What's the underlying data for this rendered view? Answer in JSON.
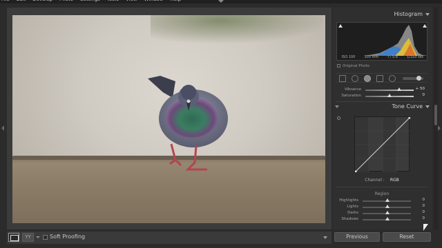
{
  "menubar": {
    "items": [
      "File",
      "Edit",
      "Develop",
      "Photo",
      "Settings",
      "Tools",
      "View",
      "Window",
      "Help"
    ]
  },
  "toolbar": {
    "view_icon": "loupe-view-icon",
    "yy_label": "YY",
    "soft_proofing_label": "Soft Proofing"
  },
  "histogram": {
    "title": "Histogram",
    "iso": "ISO 100",
    "focal": "300 mm",
    "aperture": "f / 5.6",
    "shutter": "1/320 sec",
    "original_photo_label": "Original Photo"
  },
  "basic": {
    "vibrance_label": "Vibrance",
    "vibrance_value": "+ 50",
    "saturation_label": "Saturation",
    "saturation_value": "0"
  },
  "tone_curve": {
    "title": "Tone Curve",
    "channel_label": "Channel :",
    "channel_value": "RGB",
    "region_label": "Region",
    "regions": [
      {
        "label": "Highlights",
        "value": "0"
      },
      {
        "label": "Lights",
        "value": "0"
      },
      {
        "label": "Darks",
        "value": "0"
      },
      {
        "label": "Shadows",
        "value": "0"
      }
    ]
  },
  "buttons": {
    "previous": "Previous",
    "reset": "Reset"
  },
  "colors": {
    "panel_bg": "#2f2f2f",
    "app_bg": "#2b2b2b",
    "accent": "#d0d0d0"
  }
}
